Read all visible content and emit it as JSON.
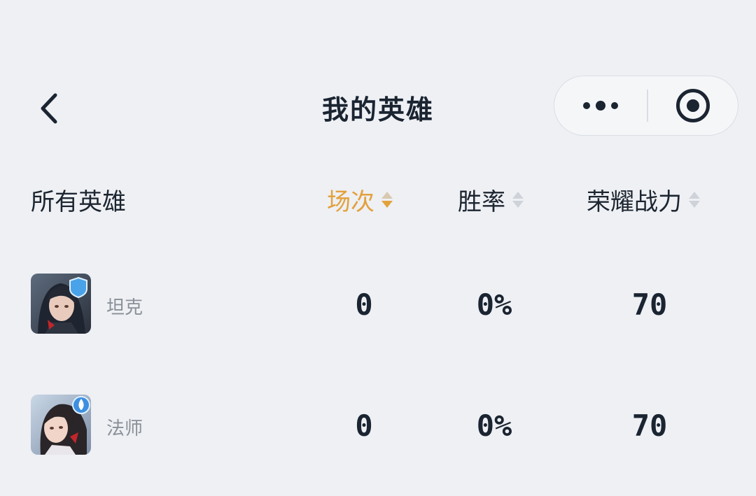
{
  "header": {
    "title": "我的英雄"
  },
  "columns": {
    "all_heroes": "所有英雄",
    "games": "场次",
    "win_rate": "胜率",
    "glory_power": "荣耀战力"
  },
  "sort": {
    "active_column": "games",
    "active_color": "#e3a13c"
  },
  "heroes": [
    {
      "role": "坦克",
      "role_icon": "shield-icon",
      "games": "0",
      "win_rate": "0%",
      "power": "70"
    },
    {
      "role": "法师",
      "role_icon": "flame-icon",
      "games": "0",
      "win_rate": "0%",
      "power": "70"
    }
  ]
}
